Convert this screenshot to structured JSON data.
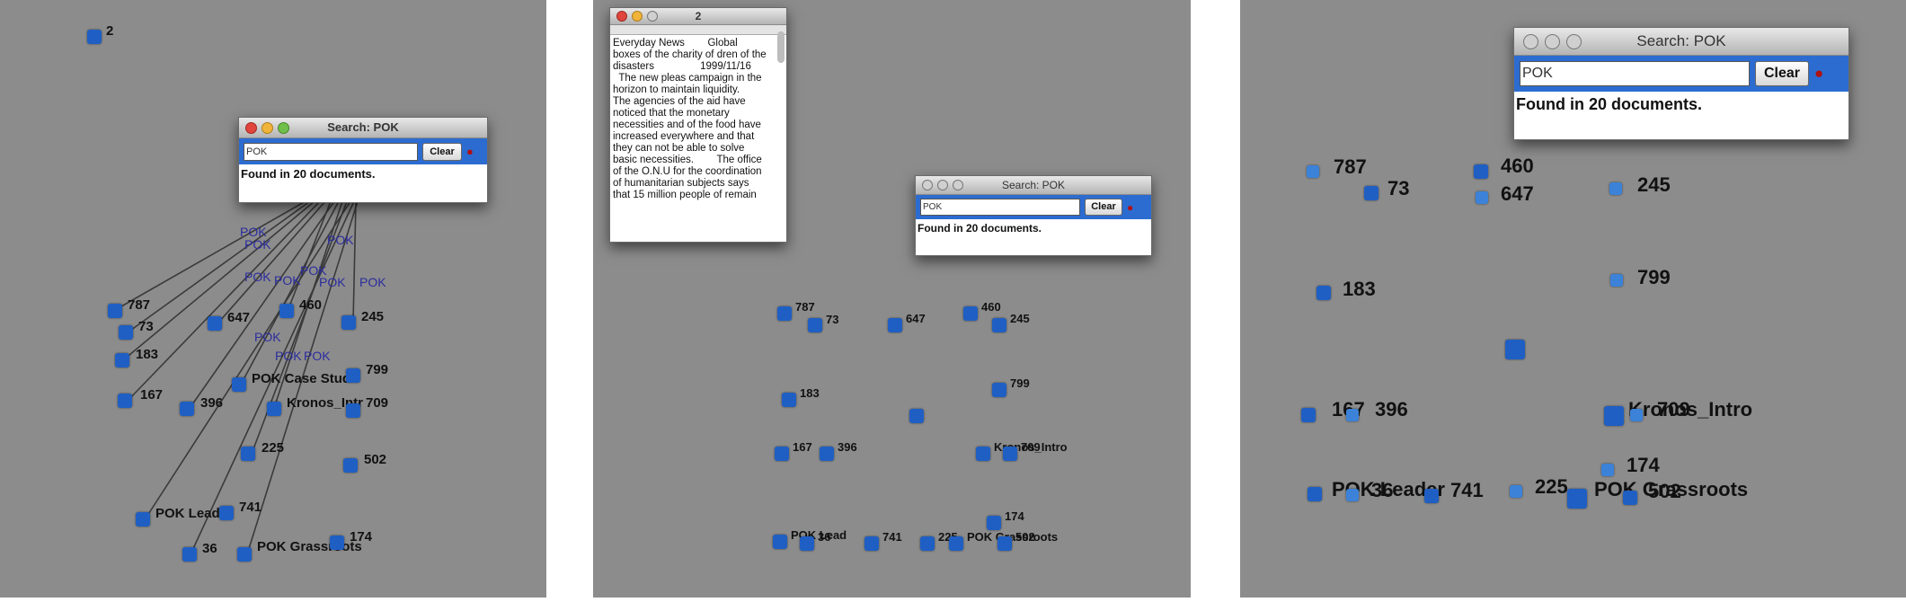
{
  "panel1": {
    "nodes": [
      {
        "label": "2"
      },
      {
        "label": "787"
      },
      {
        "label": "73"
      },
      {
        "label": "183"
      },
      {
        "label": "167"
      },
      {
        "label": "647"
      },
      {
        "label": "460"
      },
      {
        "label": "245"
      },
      {
        "label": "396"
      },
      {
        "label": "POK Case Stud"
      },
      {
        "label": "Kronos_Intr"
      },
      {
        "label": "799"
      },
      {
        "label": "709"
      },
      {
        "label": "225"
      },
      {
        "label": "502"
      },
      {
        "label": "POK Lead"
      },
      {
        "label": "741"
      },
      {
        "label": "36"
      },
      {
        "label": "POK Grassroots"
      },
      {
        "label": "174"
      }
    ],
    "keyword_label": "POK",
    "search": {
      "title": "Search: POK",
      "value": "POK",
      "clear_label": "Clear",
      "result": "Found in 20 documents."
    }
  },
  "panel2": {
    "doc_window": {
      "title": "2",
      "text": "Everyday News        Global\nboxes of the charity of dren of the\ndisasters                1999/11/16\n  The new pleas campaign in the\nhorizon to maintain liquidity.\nThe agencies of the aid have\nnoticed that the monetary\nnecessities and of the food have\nincreased everywhere and that\nthey can not be able to solve\nbasic necessities.        The office\nof the O.N.U for the coordination\nof humanitarian subjects says\nthat 15 million people of remain"
    },
    "search": {
      "title": "Search: POK",
      "value": "POK",
      "clear_label": "Clear",
      "result": "Found in 20 documents."
    },
    "nodes": [
      {
        "label": "787"
      },
      {
        "label": "73"
      },
      {
        "label": "647"
      },
      {
        "label": "460"
      },
      {
        "label": "245"
      },
      {
        "label": "183"
      },
      {
        "label": "799"
      },
      {
        "label": ""
      },
      {
        "label": "167"
      },
      {
        "label": "396"
      },
      {
        "label": "Kronos_Intro"
      },
      {
        "label": "709"
      },
      {
        "label": "174"
      },
      {
        "label": "POK Lead"
      },
      {
        "label": "36"
      },
      {
        "label": "741"
      },
      {
        "label": "225"
      },
      {
        "label": "POK Grassroots"
      },
      {
        "label": "502"
      }
    ]
  },
  "panel3": {
    "search": {
      "title": "Search: POK",
      "value": "POK",
      "clear_label": "Clear",
      "result": "Found in 20 documents."
    },
    "nodes": [
      {
        "label": "787"
      },
      {
        "label": "73"
      },
      {
        "label": "460"
      },
      {
        "label": "647"
      },
      {
        "label": "245"
      },
      {
        "label": "183"
      },
      {
        "label": "799"
      },
      {
        "label": ""
      },
      {
        "label": "167"
      },
      {
        "label": "396"
      },
      {
        "label": "Kronos_Intro"
      },
      {
        "label": "709"
      },
      {
        "label": "174"
      },
      {
        "label": "POK Leader"
      },
      {
        "label": "36"
      },
      {
        "label": "741"
      },
      {
        "label": "225"
      },
      {
        "label": "POK Grassroots"
      },
      {
        "label": "502"
      }
    ]
  },
  "colors": {
    "canvas": "#8c8c8c",
    "node": "#1f5fc4",
    "searchbar": "#2c6cd0",
    "keyword": "#2b2c9e"
  },
  "icons": {
    "pin": "pushpin-icon",
    "close": "close-dot-icon",
    "minimize": "minimize-dot-icon",
    "zoom": "zoom-dot-icon"
  }
}
